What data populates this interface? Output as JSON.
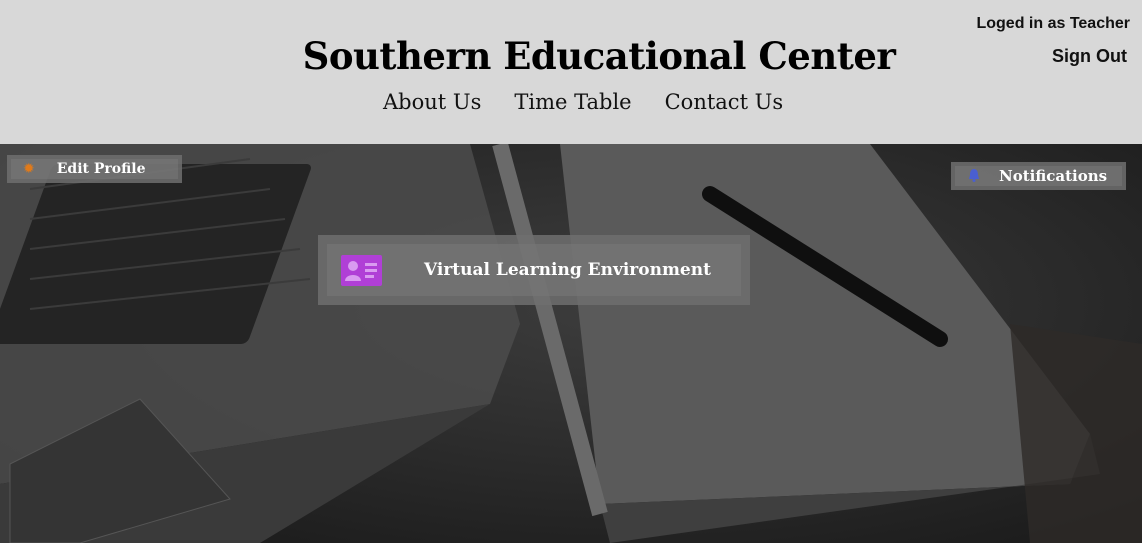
{
  "header": {
    "title": "Southern Educational Center",
    "nav": [
      "About Us",
      "Time Table",
      "Contact Us"
    ],
    "login_status": "Loged in as Teacher",
    "sign_out": "Sign Out"
  },
  "hero": {
    "edit_profile": {
      "label": "Edit Profile",
      "icon": "gear-icon",
      "icon_color": "#e07a1a"
    },
    "notifications": {
      "label": "Notifications",
      "icon": "bell-icon",
      "icon_color": "#4a5fd0"
    },
    "vle": {
      "label": "Virtual Learning Environment",
      "icon": "id-card-icon",
      "icon_color": "#b03fd6"
    }
  },
  "colors": {
    "header_bg": "#d8d8d8",
    "button_bg": "#6e6e6e"
  }
}
